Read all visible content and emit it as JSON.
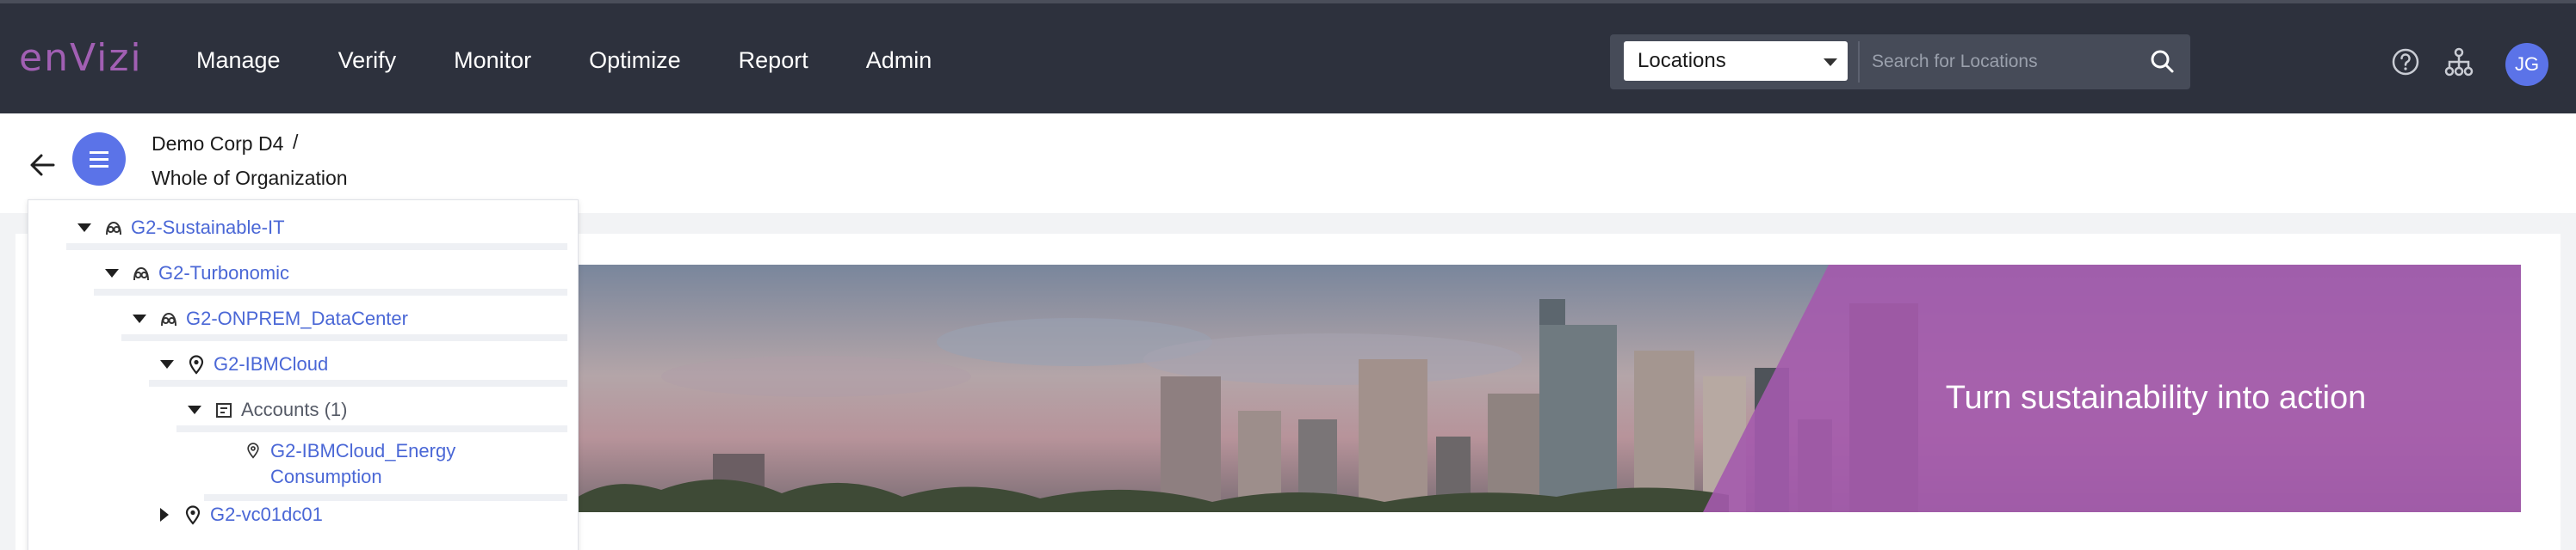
{
  "app": {
    "logo_text": "enVizi"
  },
  "nav": {
    "items": [
      "Manage",
      "Verify",
      "Monitor",
      "Optimize",
      "Report",
      "Admin"
    ]
  },
  "search": {
    "scope_value": "Locations",
    "placeholder": "Search for Locations"
  },
  "header": {
    "avatar_initials": "JG",
    "help_icon": "help-icon",
    "hierarchy_icon": "hierarchy-icon"
  },
  "breadcrumb": {
    "org": "Demo Corp D4",
    "separator": "/",
    "current": "Whole of Organization"
  },
  "tree": {
    "rows": [
      {
        "label": "G2-Sustainable-IT",
        "icon": "group-icon",
        "expanded": true
      },
      {
        "label": "G2-Turbonomic",
        "icon": "group-icon",
        "expanded": true
      },
      {
        "label": "G2-ONPREM_DataCenter",
        "icon": "group-icon",
        "expanded": true
      },
      {
        "label": "G2-IBMCloud",
        "icon": "location-pin-icon",
        "expanded": true
      },
      {
        "label": "Accounts (1)",
        "icon": "accounts-icon",
        "expanded": true
      },
      {
        "label_line1": "G2-IBMCloud_Energy",
        "label_line2": "Consumption",
        "icon": "location-pin-icon"
      },
      {
        "label": "G2-vc01dc01",
        "icon": "location-pin-icon",
        "expanded": false
      }
    ]
  },
  "banner": {
    "title": "Turn sustainability into action",
    "accent_color": "#a45aad"
  },
  "colors": {
    "topbar": "#2d313d",
    "accent": "#5b73e8",
    "link": "#4a67d6",
    "logo": "#a15fb3"
  }
}
